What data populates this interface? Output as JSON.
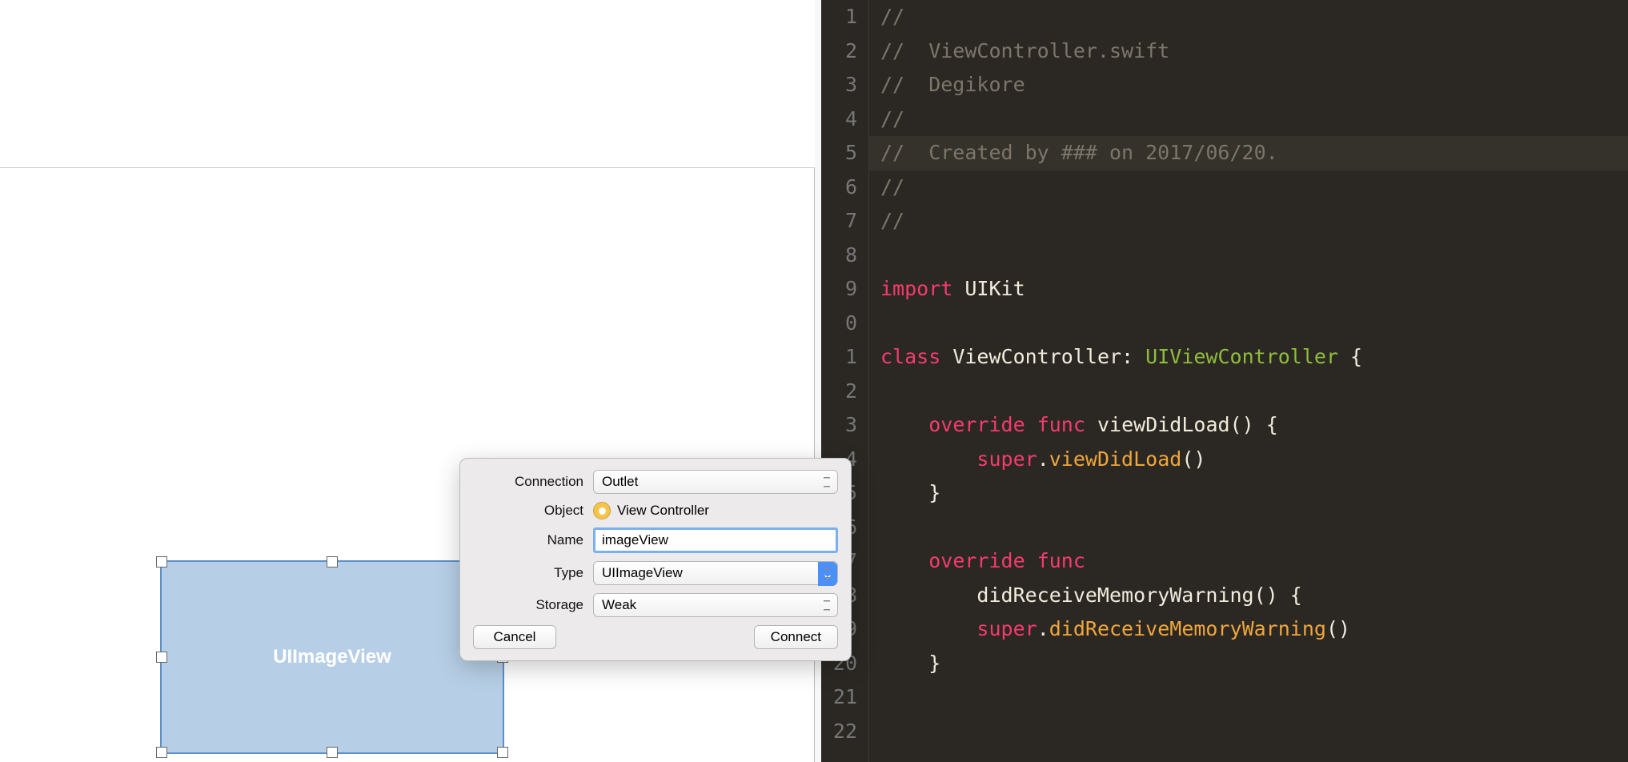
{
  "interface_builder": {
    "selected_element_label": "UIImageView"
  },
  "popover": {
    "labels": {
      "connection": "Connection",
      "object": "Object",
      "name": "Name",
      "type": "Type",
      "storage": "Storage"
    },
    "values": {
      "connection": "Outlet",
      "object": "View Controller",
      "name": "imageView",
      "type": "UIImageView",
      "storage": "Weak"
    },
    "buttons": {
      "cancel": "Cancel",
      "connect": "Connect"
    }
  },
  "editor": {
    "line_numbers": [
      "1",
      "2",
      "3",
      "4",
      "5",
      "6",
      "7",
      "8",
      "9",
      "0",
      "1",
      "2",
      "3",
      "4",
      "5",
      "16",
      "17",
      "18",
      "19",
      "20",
      "21",
      "22"
    ],
    "highlighted_line_index": 4,
    "code": {
      "l1": "//",
      "l2": "//  ViewController.swift",
      "l3": "//  Degikore",
      "l4": "//",
      "l5": "//  Created by ### on 2017/06/20.",
      "l6": "//",
      "l7": "//",
      "l9_import": "import",
      "l9_uikit": "UIKit",
      "l11_class": "class",
      "l11_name": "ViewController:",
      "l11_super": "UIViewController",
      "l11_brace": " {",
      "l13_override": "override",
      "l13_func": "func",
      "l13_sig": "viewDidLoad() {",
      "l14_super": "super",
      "l14_dot": ".",
      "l14_call": "viewDidLoad",
      "l14_par": "()",
      "l15_brace": "}",
      "l17_override": "override",
      "l17_func": "func",
      "l17b_sig": "didReceiveMemoryWarning() {",
      "l18_super": "super",
      "l18_dot": ".",
      "l18_call": "didReceiveMemoryWarning",
      "l18_par": "()",
      "l19_brace": "}"
    }
  }
}
